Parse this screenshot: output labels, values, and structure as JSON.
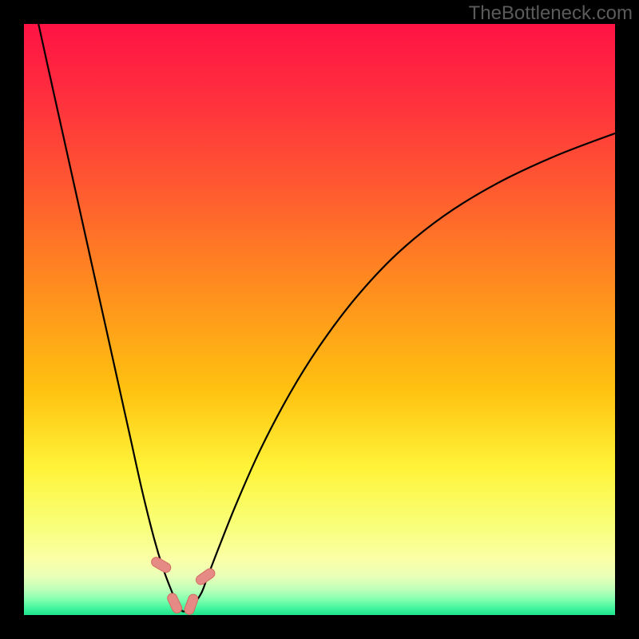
{
  "watermark": "TheBottleneck.com",
  "colors": {
    "frame": "#000000",
    "curve": "#000000",
    "marker_fill": "#e58a84",
    "marker_stroke": "#d46a62",
    "gradient_stops": [
      {
        "offset": 0.0,
        "color": "#ff1344"
      },
      {
        "offset": 0.12,
        "color": "#ff2e3e"
      },
      {
        "offset": 0.28,
        "color": "#ff5a30"
      },
      {
        "offset": 0.45,
        "color": "#ff8e1e"
      },
      {
        "offset": 0.62,
        "color": "#ffc210"
      },
      {
        "offset": 0.75,
        "color": "#fff338"
      },
      {
        "offset": 0.85,
        "color": "#f8ff7a"
      },
      {
        "offset": 0.905,
        "color": "#fbffa6"
      },
      {
        "offset": 0.935,
        "color": "#e9ffb8"
      },
      {
        "offset": 0.958,
        "color": "#baffb9"
      },
      {
        "offset": 0.975,
        "color": "#7dffae"
      },
      {
        "offset": 0.988,
        "color": "#44f69e"
      },
      {
        "offset": 1.0,
        "color": "#1ee48d"
      }
    ]
  },
  "chart_data": {
    "type": "line",
    "title": "",
    "xlabel": "",
    "ylabel": "",
    "xlim": [
      0,
      100
    ],
    "ylim": [
      0,
      100
    ],
    "x_min_percent": 27,
    "series": [
      {
        "name": "bottleneck-curve",
        "x": [
          0,
          2,
          4,
          6,
          8,
          10,
          12,
          14,
          16,
          18,
          20,
          22,
          23.5,
          25,
          26,
          27,
          28.5,
          30,
          31,
          33,
          36,
          40,
          45,
          50,
          56,
          63,
          71,
          80,
          90,
          100
        ],
        "y": [
          110,
          102,
          93,
          84,
          75,
          66,
          57,
          48,
          39,
          30,
          21,
          13,
          8,
          4,
          1.8,
          0.6,
          1.6,
          3.7,
          6.3,
          11.5,
          19,
          28,
          37.5,
          45.5,
          53.5,
          61,
          67.5,
          73,
          77.7,
          81.5
        ]
      }
    ],
    "markers": [
      {
        "x": 23.2,
        "y": 8.5,
        "rot": -60
      },
      {
        "x": 25.5,
        "y": 2.0,
        "rot": -25
      },
      {
        "x": 28.3,
        "y": 1.8,
        "rot": 20
      },
      {
        "x": 30.7,
        "y": 6.5,
        "rot": 55
      }
    ]
  }
}
